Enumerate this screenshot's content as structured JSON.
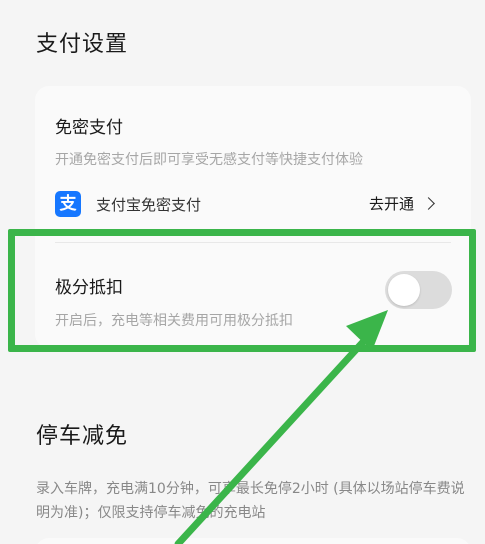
{
  "payment_section": {
    "title": "支付设置"
  },
  "password_free": {
    "title": "免密支付",
    "description": "开通免密支付后即可享受无感支付等快捷支付体验",
    "alipay_logo_char": "支",
    "alipay_label": "支付宝免密支付",
    "open_label": "去开通"
  },
  "credit_deduction": {
    "title": "极分抵扣",
    "description": "开启后，充电等相关费用可用极分抵扣",
    "toggle_on": false
  },
  "parking_section": {
    "title": "停车减免",
    "description": "录入车牌，充电满10分钟，可享最长免停2小时 (具体以场站停车费说明为准)；仅限支持停车减免的充电站"
  },
  "colors": {
    "highlight": "#3bb54a",
    "alipay_blue": "#1677ff",
    "toggle_off": "#dcdcdc"
  }
}
